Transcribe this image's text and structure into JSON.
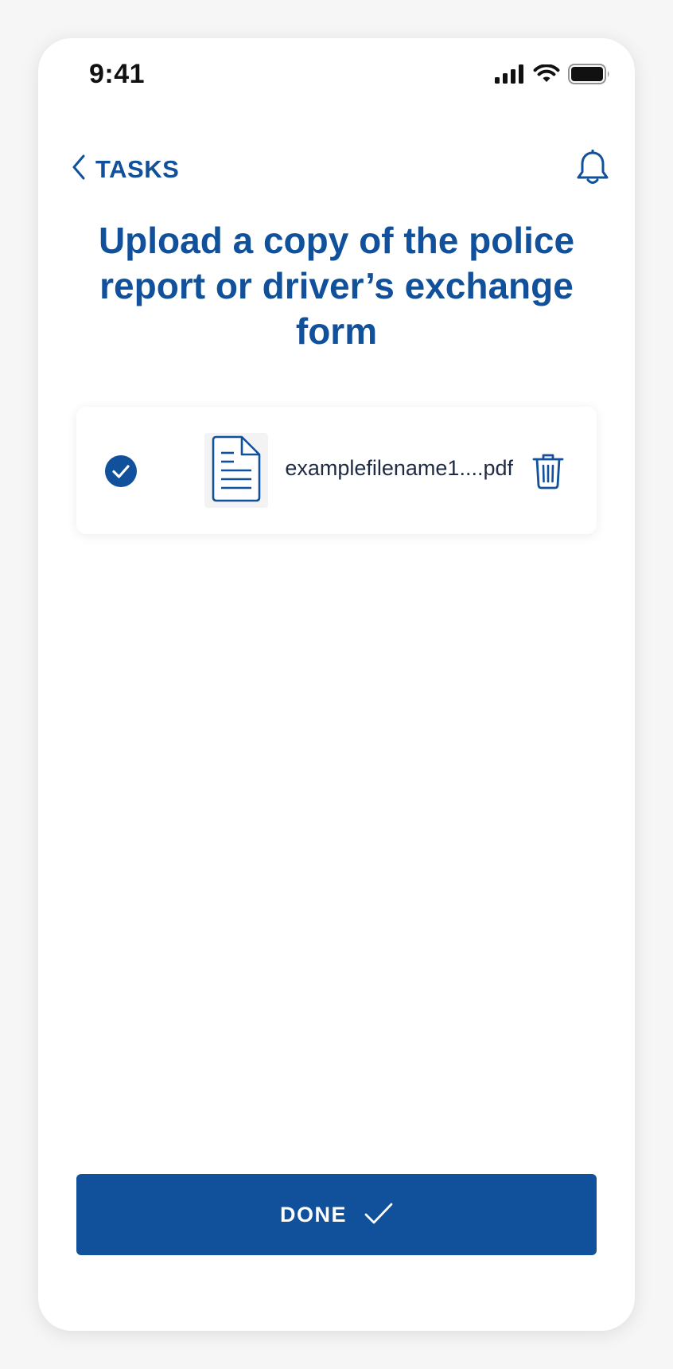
{
  "status_bar": {
    "time": "9:41",
    "icons": [
      "cellular-signal-icon",
      "wifi-icon",
      "battery-icon"
    ]
  },
  "nav": {
    "back_label": "TASKS",
    "back_icon": "chevron-left-icon",
    "notification_icon": "bell-icon"
  },
  "page": {
    "title": "Upload a copy of the police report or driver’s exchange form"
  },
  "file_card": {
    "status_icon": "check-circle-icon",
    "file_icon": "document-icon",
    "file_name": "examplefilename1....pdf",
    "delete_icon": "trash-icon"
  },
  "footer": {
    "done_label": "DONE",
    "done_icon": "checkmark-icon"
  },
  "colors": {
    "brand": "#11509a",
    "background": "#ffffff",
    "page_background": "#f6f6f6",
    "text_dark": "#1f2a44"
  }
}
